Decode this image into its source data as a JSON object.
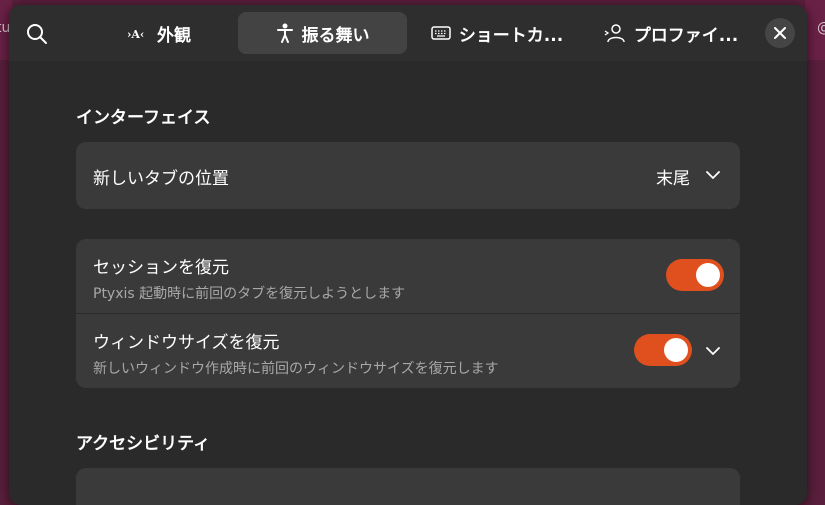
{
  "background": {
    "left_fragment": "tu",
    "right_fragment": "@"
  },
  "tabs": [
    {
      "label": "外観",
      "icon": "text-appearance-icon"
    },
    {
      "label": "振る舞い",
      "icon": "accessibility-person-icon",
      "active": true
    },
    {
      "label": "ショートカ...",
      "icon": "keyboard-icon"
    },
    {
      "label": "プロファイ...",
      "icon": "profile-user-icon"
    }
  ],
  "header": {
    "search_icon": "search-icon",
    "close_icon": "close-icon"
  },
  "sections": {
    "interface": {
      "title": "インターフェイス",
      "new_tab_position": {
        "label": "新しいタブの位置",
        "value": "末尾"
      },
      "restore_session": {
        "title": "セッションを復元",
        "subtitle": "Ptyxis 起動時に前回のタブを復元しようとします",
        "enabled": true
      },
      "restore_window_size": {
        "title": "ウィンドウサイズを復元",
        "subtitle": "新しいウィンドウ作成時に前回のウィンドウサイズを復元します",
        "enabled": true
      }
    },
    "accessibility": {
      "title": "アクセシビリティ"
    }
  },
  "colors": {
    "accent": "#e0501e",
    "dialog_bg": "#2a2a2a",
    "card_bg": "#3a3a3a",
    "backdrop": "#5a1f3c"
  }
}
